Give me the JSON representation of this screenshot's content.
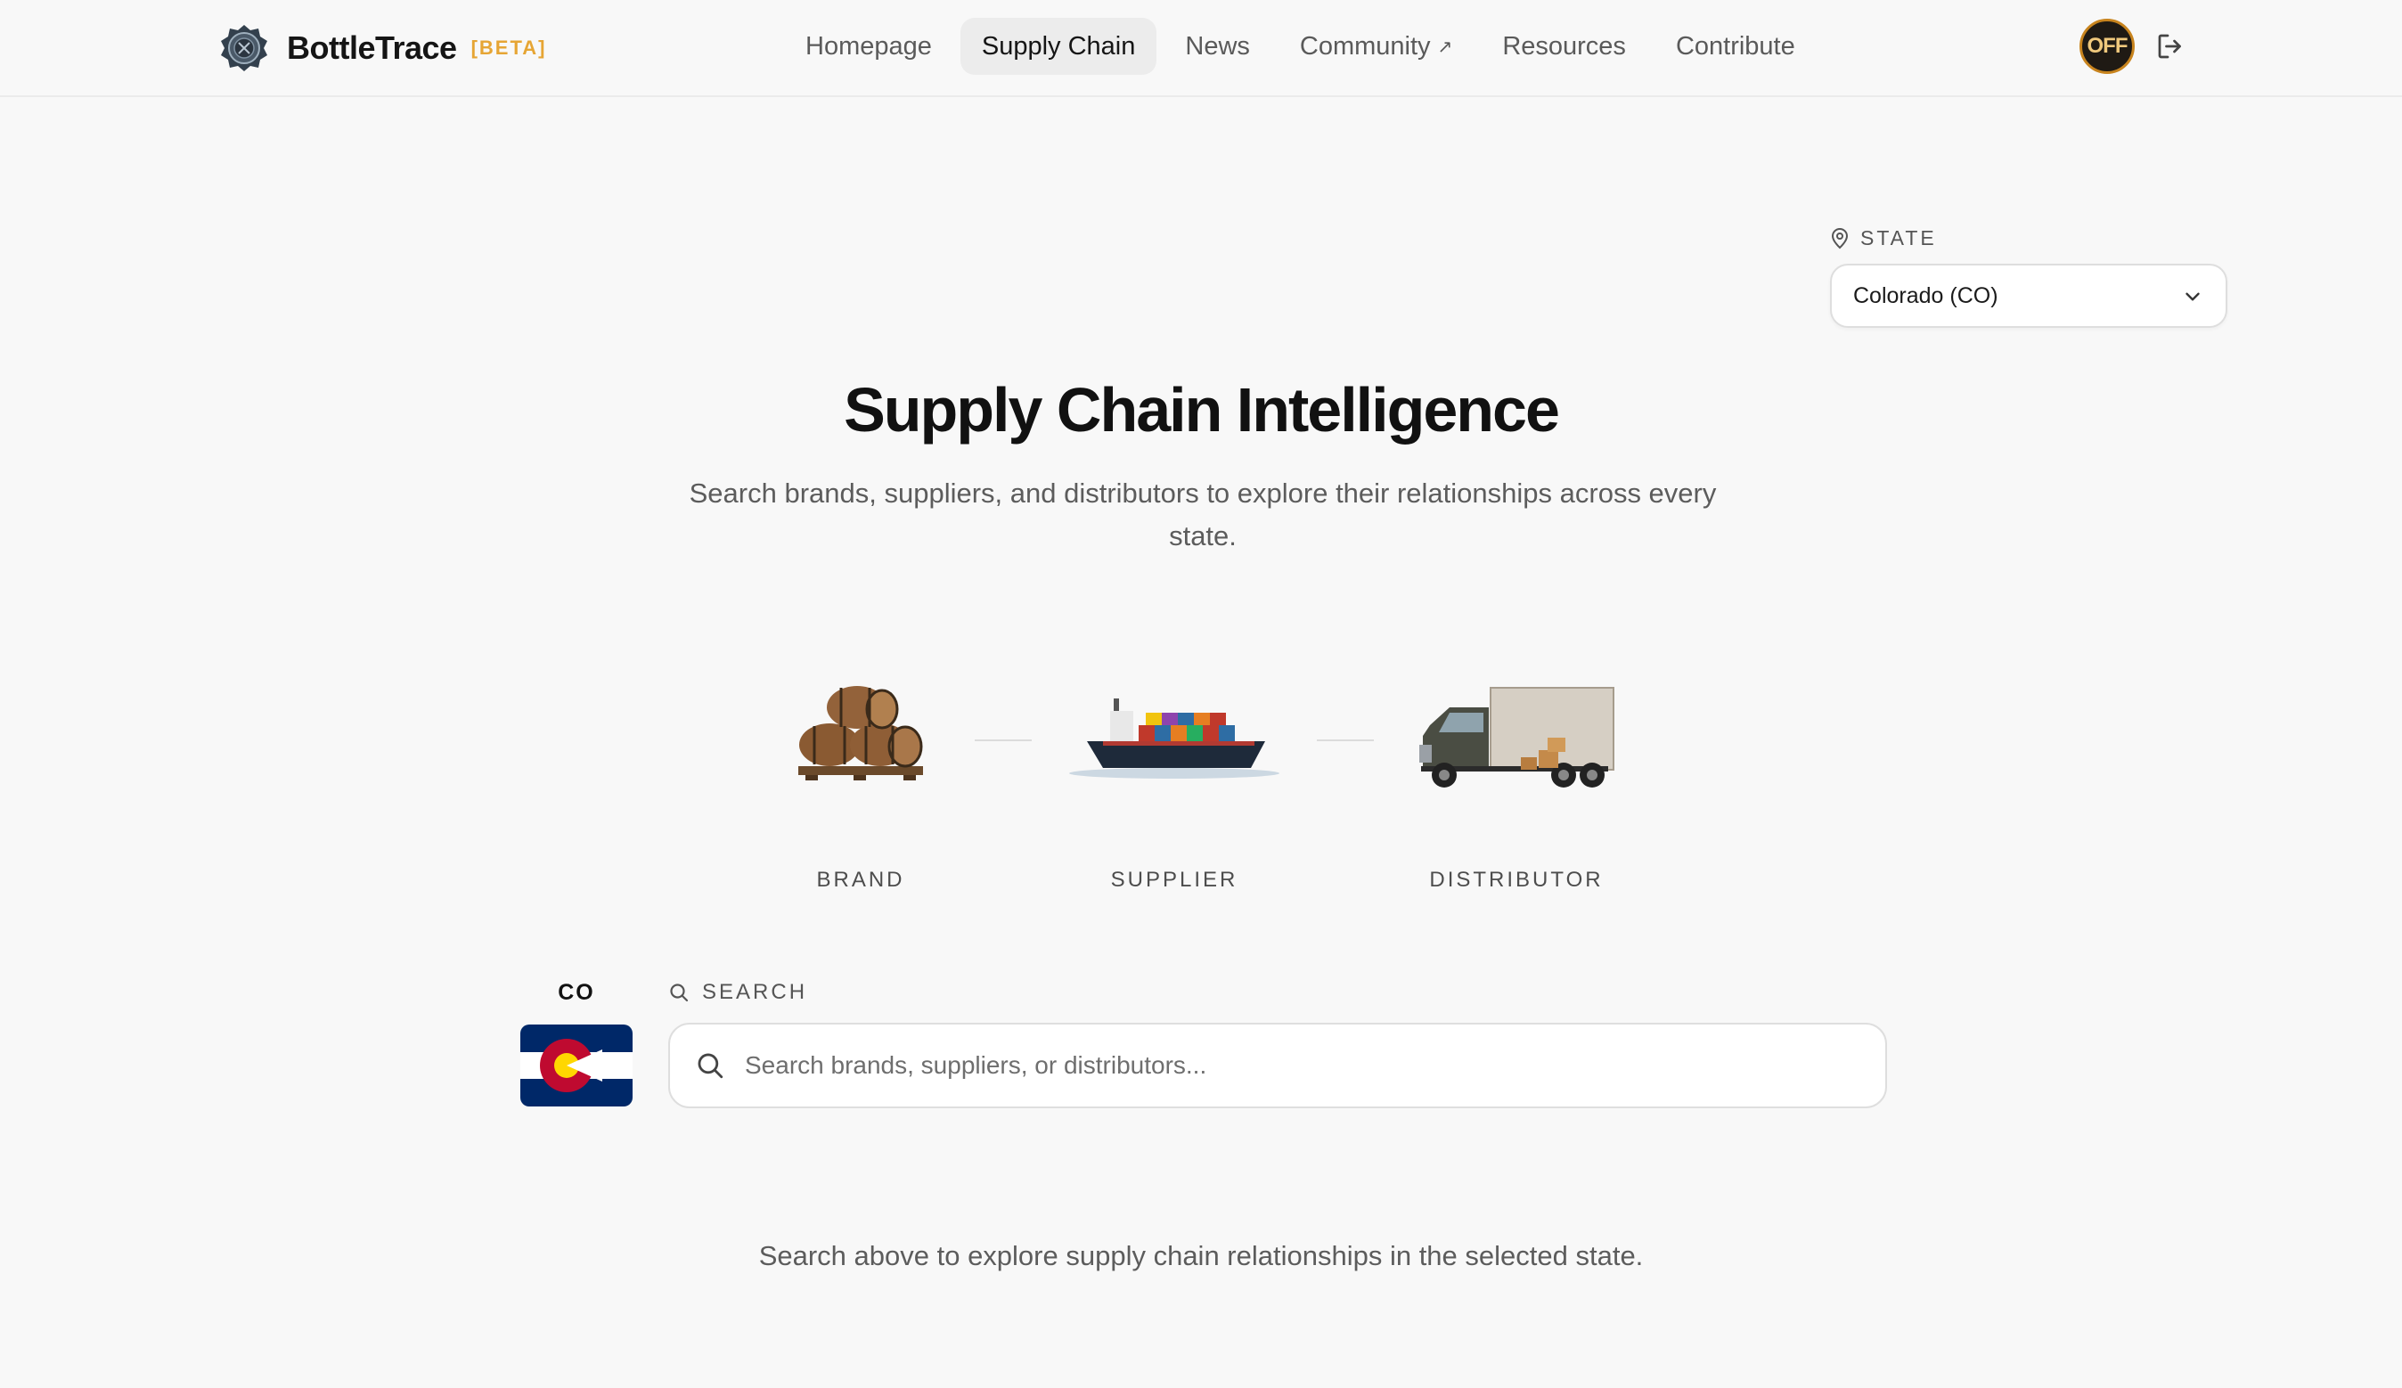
{
  "brand": {
    "name": "BottleTrace",
    "badge": "[BETA]"
  },
  "nav": {
    "items": [
      {
        "label": "Homepage"
      },
      {
        "label": "Supply Chain",
        "active": true
      },
      {
        "label": "News"
      },
      {
        "label": "Community",
        "external_icon": "↗"
      },
      {
        "label": "Resources"
      },
      {
        "label": "Contribute"
      }
    ]
  },
  "user": {
    "avatar_text": "OFF"
  },
  "icons": {
    "logo": "bottletrace-seal-icon",
    "logout": "logout-icon",
    "state_pin": "location-pin-icon",
    "chevron": "chevron-down-icon",
    "search": "search-icon"
  },
  "state_selector": {
    "label": "STATE",
    "value": "Colorado (CO)"
  },
  "hero": {
    "title": "Supply Chain Intelligence",
    "subtitle": "Search brands, suppliers, and distributors to explore their relationships across every state."
  },
  "flow": [
    {
      "label": "BRAND",
      "icon": "barrels-icon"
    },
    {
      "label": "SUPPLIER",
      "icon": "cargo-ship-icon"
    },
    {
      "label": "DISTRIBUTOR",
      "icon": "delivery-truck-icon"
    }
  ],
  "search": {
    "state_code": "CO",
    "label": "SEARCH",
    "placeholder": "Search brands, suppliers, or distributors...",
    "value": ""
  },
  "hint": "Search above to explore supply chain relationships in the selected state.",
  "colors": {
    "background": "#f8f8f8",
    "badge": "#e6a534",
    "avatar_ring": "#c8841e",
    "flag_blue": "#002868",
    "flag_red": "#bf0a30",
    "flag_gold": "#ffd700"
  }
}
